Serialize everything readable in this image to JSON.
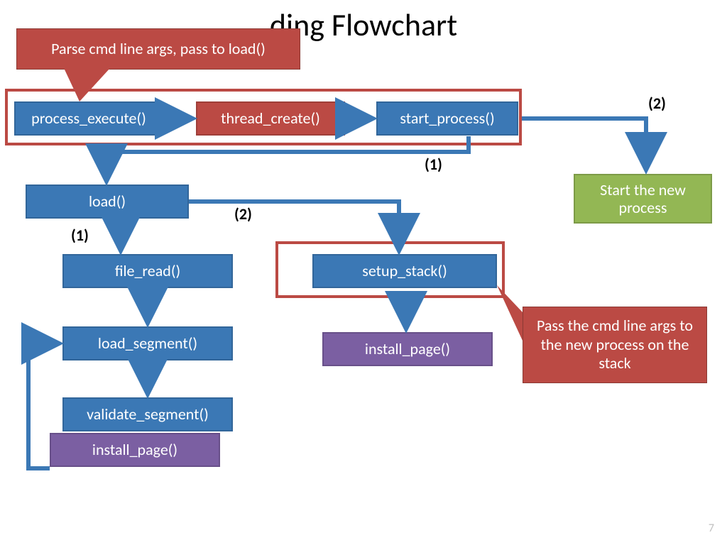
{
  "title": "ding Flowchart",
  "page_number": "7",
  "callouts": {
    "parse": "Parse cmd line args, pass to load()",
    "stack": "Pass the cmd line args to the new process on the stack"
  },
  "labels": {
    "top_2": "(2)",
    "mid_1": "(1)",
    "left_1": "(1)",
    "left_2": "(2)"
  },
  "nodes": {
    "process_execute": "process_execute()",
    "thread_create": "thread_create()",
    "start_process": "start_process()",
    "start_new_process": "Start the new process",
    "load": "load()",
    "file_read": "file_read()",
    "setup_stack": "setup_stack()",
    "install_page_right": "install_page()",
    "load_segment": "load_segment()",
    "validate_segment": "validate_segment()",
    "install_page_left": "install_page()"
  }
}
